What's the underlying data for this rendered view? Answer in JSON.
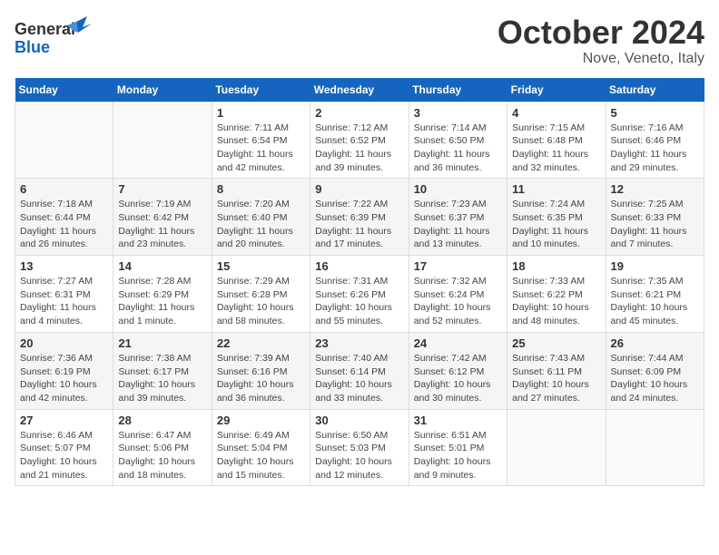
{
  "header": {
    "logo_line1": "General",
    "logo_line2": "Blue",
    "month": "October 2024",
    "location": "Nove, Veneto, Italy"
  },
  "weekdays": [
    "Sunday",
    "Monday",
    "Tuesday",
    "Wednesday",
    "Thursday",
    "Friday",
    "Saturday"
  ],
  "weeks": [
    [
      {
        "day": "",
        "info": ""
      },
      {
        "day": "",
        "info": ""
      },
      {
        "day": "1",
        "info": "Sunrise: 7:11 AM\nSunset: 6:54 PM\nDaylight: 11 hours and 42 minutes."
      },
      {
        "day": "2",
        "info": "Sunrise: 7:12 AM\nSunset: 6:52 PM\nDaylight: 11 hours and 39 minutes."
      },
      {
        "day": "3",
        "info": "Sunrise: 7:14 AM\nSunset: 6:50 PM\nDaylight: 11 hours and 36 minutes."
      },
      {
        "day": "4",
        "info": "Sunrise: 7:15 AM\nSunset: 6:48 PM\nDaylight: 11 hours and 32 minutes."
      },
      {
        "day": "5",
        "info": "Sunrise: 7:16 AM\nSunset: 6:46 PM\nDaylight: 11 hours and 29 minutes."
      }
    ],
    [
      {
        "day": "6",
        "info": "Sunrise: 7:18 AM\nSunset: 6:44 PM\nDaylight: 11 hours and 26 minutes."
      },
      {
        "day": "7",
        "info": "Sunrise: 7:19 AM\nSunset: 6:42 PM\nDaylight: 11 hours and 23 minutes."
      },
      {
        "day": "8",
        "info": "Sunrise: 7:20 AM\nSunset: 6:40 PM\nDaylight: 11 hours and 20 minutes."
      },
      {
        "day": "9",
        "info": "Sunrise: 7:22 AM\nSunset: 6:39 PM\nDaylight: 11 hours and 17 minutes."
      },
      {
        "day": "10",
        "info": "Sunrise: 7:23 AM\nSunset: 6:37 PM\nDaylight: 11 hours and 13 minutes."
      },
      {
        "day": "11",
        "info": "Sunrise: 7:24 AM\nSunset: 6:35 PM\nDaylight: 11 hours and 10 minutes."
      },
      {
        "day": "12",
        "info": "Sunrise: 7:25 AM\nSunset: 6:33 PM\nDaylight: 11 hours and 7 minutes."
      }
    ],
    [
      {
        "day": "13",
        "info": "Sunrise: 7:27 AM\nSunset: 6:31 PM\nDaylight: 11 hours and 4 minutes."
      },
      {
        "day": "14",
        "info": "Sunrise: 7:28 AM\nSunset: 6:29 PM\nDaylight: 11 hours and 1 minute."
      },
      {
        "day": "15",
        "info": "Sunrise: 7:29 AM\nSunset: 6:28 PM\nDaylight: 10 hours and 58 minutes."
      },
      {
        "day": "16",
        "info": "Sunrise: 7:31 AM\nSunset: 6:26 PM\nDaylight: 10 hours and 55 minutes."
      },
      {
        "day": "17",
        "info": "Sunrise: 7:32 AM\nSunset: 6:24 PM\nDaylight: 10 hours and 52 minutes."
      },
      {
        "day": "18",
        "info": "Sunrise: 7:33 AM\nSunset: 6:22 PM\nDaylight: 10 hours and 48 minutes."
      },
      {
        "day": "19",
        "info": "Sunrise: 7:35 AM\nSunset: 6:21 PM\nDaylight: 10 hours and 45 minutes."
      }
    ],
    [
      {
        "day": "20",
        "info": "Sunrise: 7:36 AM\nSunset: 6:19 PM\nDaylight: 10 hours and 42 minutes."
      },
      {
        "day": "21",
        "info": "Sunrise: 7:38 AM\nSunset: 6:17 PM\nDaylight: 10 hours and 39 minutes."
      },
      {
        "day": "22",
        "info": "Sunrise: 7:39 AM\nSunset: 6:16 PM\nDaylight: 10 hours and 36 minutes."
      },
      {
        "day": "23",
        "info": "Sunrise: 7:40 AM\nSunset: 6:14 PM\nDaylight: 10 hours and 33 minutes."
      },
      {
        "day": "24",
        "info": "Sunrise: 7:42 AM\nSunset: 6:12 PM\nDaylight: 10 hours and 30 minutes."
      },
      {
        "day": "25",
        "info": "Sunrise: 7:43 AM\nSunset: 6:11 PM\nDaylight: 10 hours and 27 minutes."
      },
      {
        "day": "26",
        "info": "Sunrise: 7:44 AM\nSunset: 6:09 PM\nDaylight: 10 hours and 24 minutes."
      }
    ],
    [
      {
        "day": "27",
        "info": "Sunrise: 6:46 AM\nSunset: 5:07 PM\nDaylight: 10 hours and 21 minutes."
      },
      {
        "day": "28",
        "info": "Sunrise: 6:47 AM\nSunset: 5:06 PM\nDaylight: 10 hours and 18 minutes."
      },
      {
        "day": "29",
        "info": "Sunrise: 6:49 AM\nSunset: 5:04 PM\nDaylight: 10 hours and 15 minutes."
      },
      {
        "day": "30",
        "info": "Sunrise: 6:50 AM\nSunset: 5:03 PM\nDaylight: 10 hours and 12 minutes."
      },
      {
        "day": "31",
        "info": "Sunrise: 6:51 AM\nSunset: 5:01 PM\nDaylight: 10 hours and 9 minutes."
      },
      {
        "day": "",
        "info": ""
      },
      {
        "day": "",
        "info": ""
      }
    ]
  ]
}
